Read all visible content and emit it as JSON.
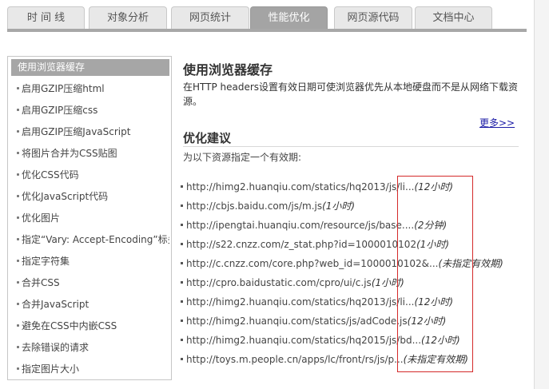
{
  "tabs": [
    {
      "label": "时 间 线",
      "active": false
    },
    {
      "label": "对象分析",
      "active": false
    },
    {
      "label": "网页统计",
      "active": false
    },
    {
      "label": "性能优化",
      "active": true
    },
    {
      "label": "网页源代码",
      "active": false
    },
    {
      "label": "文档中心",
      "active": false
    }
  ],
  "sidebar": {
    "items": [
      {
        "label": "使用浏览器缓存",
        "active": true
      },
      {
        "label": "启用GZIP压缩html"
      },
      {
        "label": "启用GZIP压缩css"
      },
      {
        "label": "启用GZIP压缩JavaScript"
      },
      {
        "label": "将图片合并为CSS贴图"
      },
      {
        "label": "优化CSS代码"
      },
      {
        "label": "优化JavaScript代码"
      },
      {
        "label": "优化图片"
      },
      {
        "label": "指定“Vary: Accept-Encoding”标头"
      },
      {
        "label": "指定字符集"
      },
      {
        "label": "合并CSS"
      },
      {
        "label": "合并JavaScript"
      },
      {
        "label": "避免在CSS中内嵌CSS"
      },
      {
        "label": "去除错误的请求"
      },
      {
        "label": "指定图片大小"
      }
    ]
  },
  "main": {
    "title": "使用浏览器缓存",
    "description": "在HTTP headers设置有效日期可使浏览器优先从本地硬盘而不是从网络下载资源。",
    "more_link": "更多>>",
    "subtitle": "优化建议",
    "intro": "为以下资源指定一个有效期:",
    "resources": [
      {
        "url": "http://himg2.huanqiu.com/statics/hq2013/js/li...",
        "expiry": "(12小时)"
      },
      {
        "url": "http://cbjs.baidu.com/js/m.js",
        "expiry": "(1小时)"
      },
      {
        "url": "http://ipengtai.huanqiu.com/resource/js/base....",
        "expiry": "(2分钟)"
      },
      {
        "url": "http://s22.cnzz.com/z_stat.php?id=1000010102",
        "expiry": "(1小时)"
      },
      {
        "url": "http://c.cnzz.com/core.php?web_id=1000010102&...",
        "expiry": "(未指定有效期)"
      },
      {
        "url": "http://cpro.baidustatic.com/cpro/ui/c.js",
        "expiry": "(1小时)"
      },
      {
        "url": "http://himg2.huanqiu.com/statics/hq2013/js/li...",
        "expiry": "(12小时)"
      },
      {
        "url": "http://himg2.huanqiu.com/statics/js/adCode.js",
        "expiry": "(12小时)"
      },
      {
        "url": "http://himg2.huanqiu.com/statics/hq2015/js/bd...",
        "expiry": "(12小时)"
      },
      {
        "url": "http://toys.m.people.cn/apps/lc/front/rs/js/p...",
        "expiry": "(未指定有效期)"
      }
    ]
  },
  "colors": {
    "active_tab": "#a4a4a4",
    "link": "#1a1aa6",
    "highlight_border": "#d42a2a"
  }
}
